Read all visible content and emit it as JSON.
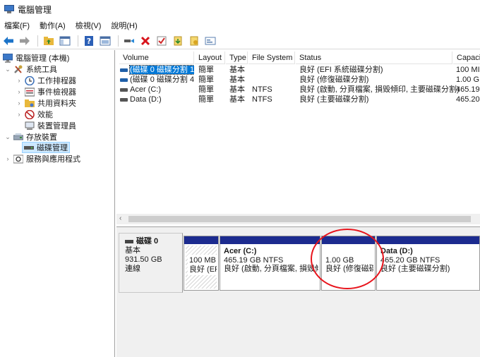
{
  "window": {
    "title": "電腦管理"
  },
  "menu": [
    "檔案(F)",
    "動作(A)",
    "檢視(V)",
    "說明(H)"
  ],
  "toolbar": [
    "back-arrow-icon",
    "forward-arrow-icon",
    "up-folder-icon",
    "show-hide-tree-icon",
    "help-icon",
    "properties-icon",
    "connect-icon",
    "delete-icon",
    "check-icon",
    "import-icon",
    "export-icon",
    "console-icon"
  ],
  "tree": {
    "root": "電腦管理 (本機)",
    "system_tools": "系統工具",
    "task_scheduler": "工作排程器",
    "event_viewer": "事件檢視器",
    "shared_folders": "共用資料夾",
    "performance": "效能",
    "device_manager": "裝置管理員",
    "storage": "存放裝置",
    "disk_management": "磁碟管理",
    "services_apps": "服務與應用程式"
  },
  "columns": [
    "Volume",
    "Layout",
    "Type",
    "File System",
    "Status",
    "Capaci"
  ],
  "volumes": [
    {
      "volume": "(磁碟 0 磁碟分割 1)",
      "layout": "簡單",
      "type": "基本",
      "fs": "",
      "status": "良好 (EFI 系統磁碟分割)",
      "capacity": "100 MI"
    },
    {
      "volume": "(磁碟 0 磁碟分割 4)",
      "layout": "簡單",
      "type": "基本",
      "fs": "",
      "status": "良好 (修復磁碟分割)",
      "capacity": "1.00 G"
    },
    {
      "volume": "Acer (C:)",
      "layout": "簡單",
      "type": "基本",
      "fs": "NTFS",
      "status": "良好 (啟動, 分頁檔案, 損毀傾印, 主要磁碟分割)",
      "capacity": "465.19"
    },
    {
      "volume": "Data (D:)",
      "layout": "簡單",
      "type": "基本",
      "fs": "NTFS",
      "status": "良好 (主要磁碟分割)",
      "capacity": "465.20"
    }
  ],
  "disk": {
    "name": "磁碟 0",
    "type": "基本",
    "size": "931.50 GB",
    "state": "連線"
  },
  "partitions": [
    {
      "name": "",
      "line1": "100 MB",
      "line2": "良好 (EF"
    },
    {
      "name": "Acer  (C:)",
      "line1": "465.19 GB NTFS",
      "line2": "良好 (啟動, 分頁檔案, 損毀傾"
    },
    {
      "name": "",
      "line1": "1.00 GB",
      "line2": "良好 (修復磁碟"
    },
    {
      "name": "Data  (D:)",
      "line1": "465.20 GB NTFS",
      "line2": "良好 (主要磁碟分割)"
    }
  ],
  "colors": {
    "partition_bar": "#1c2b8f",
    "selection": "#0078d7",
    "highlight_circle": "#e8141c"
  }
}
